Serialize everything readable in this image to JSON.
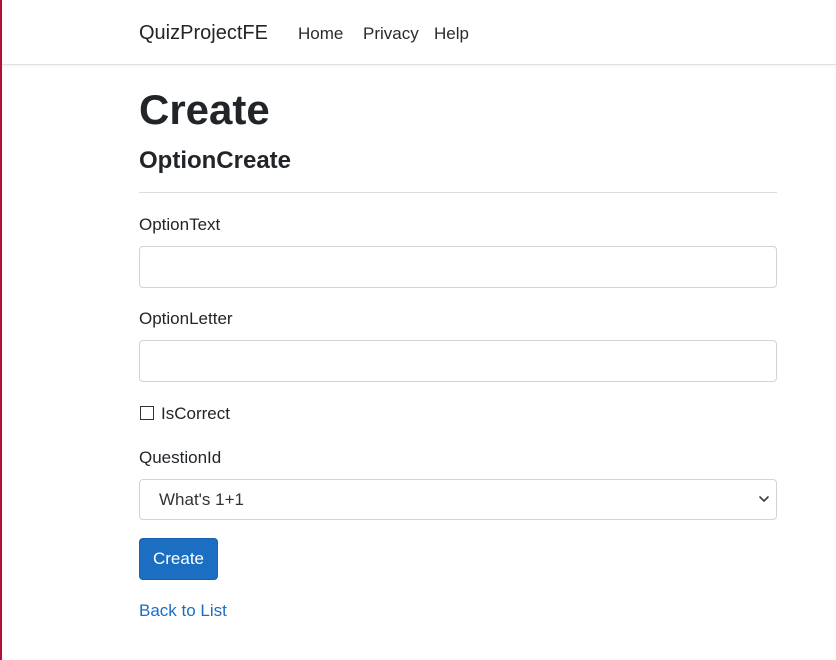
{
  "navbar": {
    "brand": "QuizProjectFE",
    "links": [
      "Home",
      "Privacy",
      "Help"
    ]
  },
  "page": {
    "title": "Create",
    "subtitle": "OptionCreate"
  },
  "form": {
    "option_text": {
      "label": "OptionText",
      "value": ""
    },
    "option_letter": {
      "label": "OptionLetter",
      "value": ""
    },
    "is_correct": {
      "label": "IsCorrect",
      "checked": false
    },
    "question_id": {
      "label": "QuestionId",
      "selected": "What's 1+1"
    },
    "submit_label": "Create"
  },
  "back_link": "Back to List",
  "colors": {
    "primary": "#1b6ec2",
    "link": "#1b6ec2",
    "text": "#212529"
  }
}
